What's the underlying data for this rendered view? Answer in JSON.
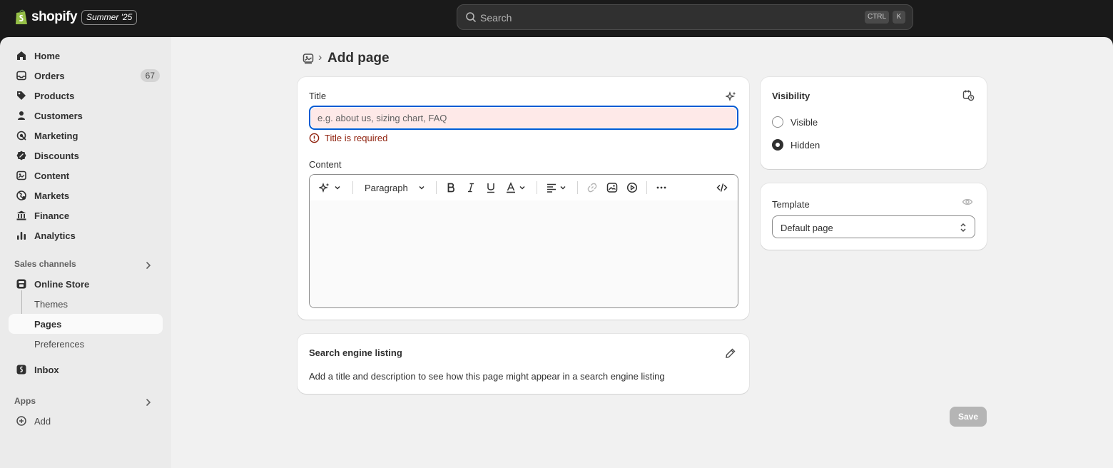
{
  "topbar": {
    "brand": "shopify",
    "edition": "Summer '25",
    "search_label": "Search",
    "shortcut_ctrl": "CTRL",
    "shortcut_key": "K"
  },
  "sidebar": {
    "items": [
      {
        "label": "Home",
        "icon": "home-icon"
      },
      {
        "label": "Orders",
        "icon": "inbox-icon",
        "badge": "67"
      },
      {
        "label": "Products",
        "icon": "tag-icon"
      },
      {
        "label": "Customers",
        "icon": "person-icon"
      },
      {
        "label": "Marketing",
        "icon": "target-icon"
      },
      {
        "label": "Discounts",
        "icon": "discount-icon"
      },
      {
        "label": "Content",
        "icon": "content-icon"
      },
      {
        "label": "Markets",
        "icon": "globe-icon"
      },
      {
        "label": "Finance",
        "icon": "bank-icon"
      },
      {
        "label": "Analytics",
        "icon": "bar-chart-icon"
      }
    ],
    "sales_channels_title": "Sales channels",
    "online_store": "Online Store",
    "store_sub": [
      "Themes",
      "Pages",
      "Preferences"
    ],
    "inbox": "Inbox",
    "apps_title": "Apps",
    "add": "Add"
  },
  "main": {
    "page_title": "Add page",
    "title_card": {
      "title_label": "Title",
      "title_placeholder": "e.g. about us, sizing chart, FAQ",
      "title_value": "",
      "error": "Title is required",
      "content_label": "Content",
      "paragraph_label": "Paragraph"
    },
    "seo_card": {
      "heading": "Search engine listing",
      "description": "Add a title and description to see how this page might appear in a search engine listing"
    },
    "visibility_card": {
      "heading": "Visibility",
      "options": [
        {
          "label": "Visible",
          "selected": false
        },
        {
          "label": "Hidden",
          "selected": true
        }
      ]
    },
    "template_card": {
      "heading": "Template",
      "selected": "Default page"
    },
    "save_label": "Save"
  },
  "colors": {
    "topbar": "#1a1a1a",
    "focus_border": "#005bd3",
    "error_text": "#8e1f0b",
    "error_bg": "#fee9e8",
    "save_disabled": "#b5b5b5"
  }
}
